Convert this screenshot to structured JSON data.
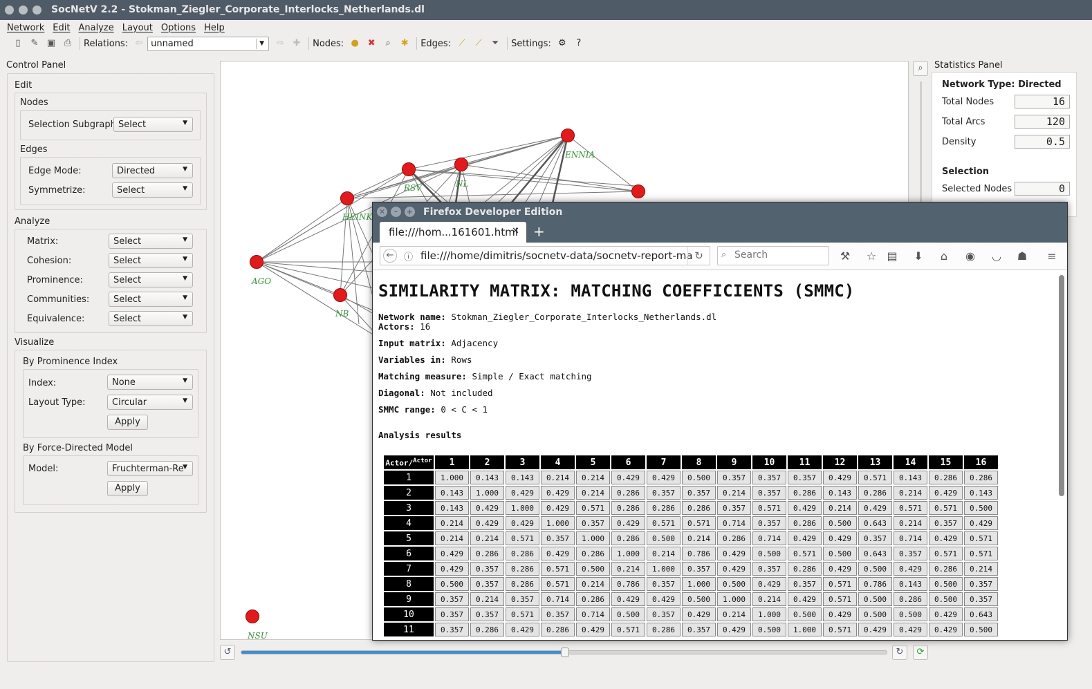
{
  "window": {
    "title": "SocNetV 2.2 - Stokman_Ziegler_Corporate_Interlocks_Netherlands.dl"
  },
  "menu": [
    "Network",
    "Edit",
    "Analyze",
    "Layout",
    "Options",
    "Help"
  ],
  "toolbar": {
    "relations_label": "Relations:",
    "relation_value": "unnamed",
    "nodes_label": "Nodes:",
    "edges_label": "Edges:",
    "settings_label": "Settings:"
  },
  "control_panel": {
    "title": "Control Panel",
    "edit": "Edit",
    "nodes": "Nodes",
    "selection_subgraph_label": "Selection Subgraph:",
    "selection_subgraph_value": "Select",
    "edges": "Edges",
    "edge_mode_label": "Edge Mode:",
    "edge_mode_value": "Directed",
    "symmetrize_label": "Symmetrize:",
    "symmetrize_value": "Select",
    "analyze": "Analyze",
    "matrix_label": "Matrix:",
    "matrix_value": "Select",
    "cohesion_label": "Cohesion:",
    "cohesion_value": "Select",
    "prominence_label": "Prominence:",
    "prominence_value": "Select",
    "communities_label": "Communities:",
    "communities_value": "Select",
    "equivalence_label": "Equivalence:",
    "equivalence_value": "Select",
    "visualize": "Visualize",
    "by_prominence": "By Prominence Index",
    "index_label": "Index:",
    "index_value": "None",
    "layout_type_label": "Layout Type:",
    "layout_type_value": "Circular",
    "apply": "Apply",
    "by_force": "By Force-Directed Model",
    "model_label": "Model:",
    "model_value": "Fruchterman-Re"
  },
  "graph": {
    "labels": [
      "ENNIA",
      "RSV",
      "NL",
      "HEINK",
      "AGO",
      "NB",
      "NSU"
    ]
  },
  "statistics_panel": {
    "title": "Statistics Panel",
    "network_type": "Network Type: Directed",
    "total_nodes_label": "Total Nodes",
    "total_nodes": "16",
    "total_arcs_label": "Total Arcs",
    "total_arcs": "120",
    "density_label": "Density",
    "density": "0.5",
    "selection": "Selection",
    "selected_nodes_label": "Selected Nodes",
    "selected_nodes": "0"
  },
  "firefox": {
    "title": "Firefox Developer Edition",
    "tab_title": "file:///hom...161601.html",
    "url": "file:///home/dimitris/socnetv-data/socnetv-report-ma",
    "search_placeholder": "Search"
  },
  "report": {
    "heading": "SIMILARITY MATRIX: MATCHING COEFFICIENTS (SMMC)",
    "network_name_label": "Network name:",
    "network_name": "Stokman_Ziegler_Corporate_Interlocks_Netherlands.dl",
    "actors_label": "Actors:",
    "actors": "16",
    "input_matrix_label": "Input matrix:",
    "input_matrix": "Adjacency",
    "variables_label": "Variables in:",
    "variables": "Rows",
    "matching_label": "Matching measure:",
    "matching": "Simple / Exact matching",
    "diagonal_label": "Diagonal:",
    "diagonal": "Not included",
    "range_label": "SMMC range:",
    "range": "0 < C < 1",
    "results": "Analysis results",
    "corner_a": "Actor/",
    "corner_b": "Actor",
    "columns": [
      "1",
      "2",
      "3",
      "4",
      "5",
      "6",
      "7",
      "8",
      "9",
      "10",
      "11",
      "12",
      "13",
      "14",
      "15",
      "16"
    ],
    "rows": [
      [
        "1",
        "1.000",
        "0.143",
        "0.143",
        "0.214",
        "0.214",
        "0.429",
        "0.429",
        "0.500",
        "0.357",
        "0.357",
        "0.357",
        "0.429",
        "0.571",
        "0.143",
        "0.286",
        "0.286"
      ],
      [
        "2",
        "0.143",
        "1.000",
        "0.429",
        "0.429",
        "0.214",
        "0.286",
        "0.357",
        "0.357",
        "0.214",
        "0.357",
        "0.286",
        "0.143",
        "0.286",
        "0.214",
        "0.429",
        "0.143"
      ],
      [
        "3",
        "0.143",
        "0.429",
        "1.000",
        "0.429",
        "0.571",
        "0.286",
        "0.286",
        "0.286",
        "0.357",
        "0.571",
        "0.429",
        "0.214",
        "0.429",
        "0.571",
        "0.571",
        "0.500"
      ],
      [
        "4",
        "0.214",
        "0.429",
        "0.429",
        "1.000",
        "0.357",
        "0.429",
        "0.571",
        "0.571",
        "0.714",
        "0.357",
        "0.286",
        "0.500",
        "0.643",
        "0.214",
        "0.357",
        "0.429"
      ],
      [
        "5",
        "0.214",
        "0.214",
        "0.571",
        "0.357",
        "1.000",
        "0.286",
        "0.500",
        "0.214",
        "0.286",
        "0.714",
        "0.429",
        "0.429",
        "0.357",
        "0.714",
        "0.429",
        "0.571"
      ],
      [
        "6",
        "0.429",
        "0.286",
        "0.286",
        "0.429",
        "0.286",
        "1.000",
        "0.214",
        "0.786",
        "0.429",
        "0.500",
        "0.571",
        "0.500",
        "0.643",
        "0.357",
        "0.571",
        "0.571"
      ],
      [
        "7",
        "0.429",
        "0.357",
        "0.286",
        "0.571",
        "0.500",
        "0.214",
        "1.000",
        "0.357",
        "0.429",
        "0.357",
        "0.286",
        "0.429",
        "0.500",
        "0.429",
        "0.286",
        "0.214"
      ],
      [
        "8",
        "0.500",
        "0.357",
        "0.286",
        "0.571",
        "0.214",
        "0.786",
        "0.357",
        "1.000",
        "0.500",
        "0.429",
        "0.357",
        "0.571",
        "0.786",
        "0.143",
        "0.500",
        "0.357"
      ],
      [
        "9",
        "0.357",
        "0.214",
        "0.357",
        "0.714",
        "0.286",
        "0.429",
        "0.429",
        "0.500",
        "1.000",
        "0.214",
        "0.429",
        "0.571",
        "0.500",
        "0.286",
        "0.500",
        "0.357"
      ],
      [
        "10",
        "0.357",
        "0.357",
        "0.571",
        "0.357",
        "0.714",
        "0.500",
        "0.357",
        "0.429",
        "0.214",
        "1.000",
        "0.500",
        "0.429",
        "0.500",
        "0.500",
        "0.429",
        "0.643"
      ],
      [
        "11",
        "0.357",
        "0.286",
        "0.429",
        "0.286",
        "0.429",
        "0.571",
        "0.286",
        "0.357",
        "0.429",
        "0.500",
        "1.000",
        "0.571",
        "0.429",
        "0.429",
        "0.429",
        "0.500"
      ]
    ]
  },
  "colors": {
    "titlebar": "#4f5b66",
    "node": "#e31a1c",
    "node_label": "#2ca02c"
  }
}
